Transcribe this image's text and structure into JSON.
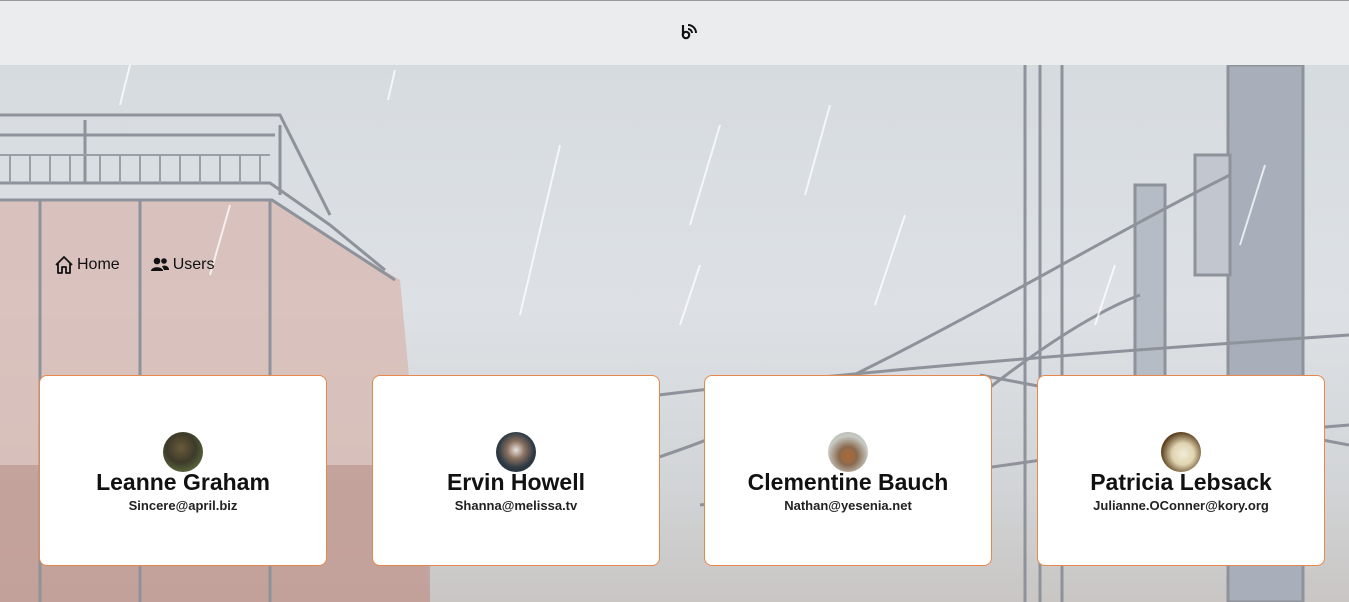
{
  "header": {
    "logo_icon": "rss-feed-icon"
  },
  "nav": {
    "items": [
      {
        "label": "Home",
        "icon": "home-icon"
      },
      {
        "label": "Users",
        "icon": "users-icon"
      }
    ]
  },
  "users": [
    {
      "name": "Leanne Graham",
      "email": "Sincere@april.biz"
    },
    {
      "name": "Ervin Howell",
      "email": "Shanna@melissa.tv"
    },
    {
      "name": "Clementine Bauch",
      "email": "Nathan@yesenia.net"
    },
    {
      "name": "Patricia Lebsack",
      "email": "Julianne.OConner@kory.org"
    }
  ],
  "colors": {
    "card_border": "#e6894e",
    "header_bg": "#ebecee"
  }
}
